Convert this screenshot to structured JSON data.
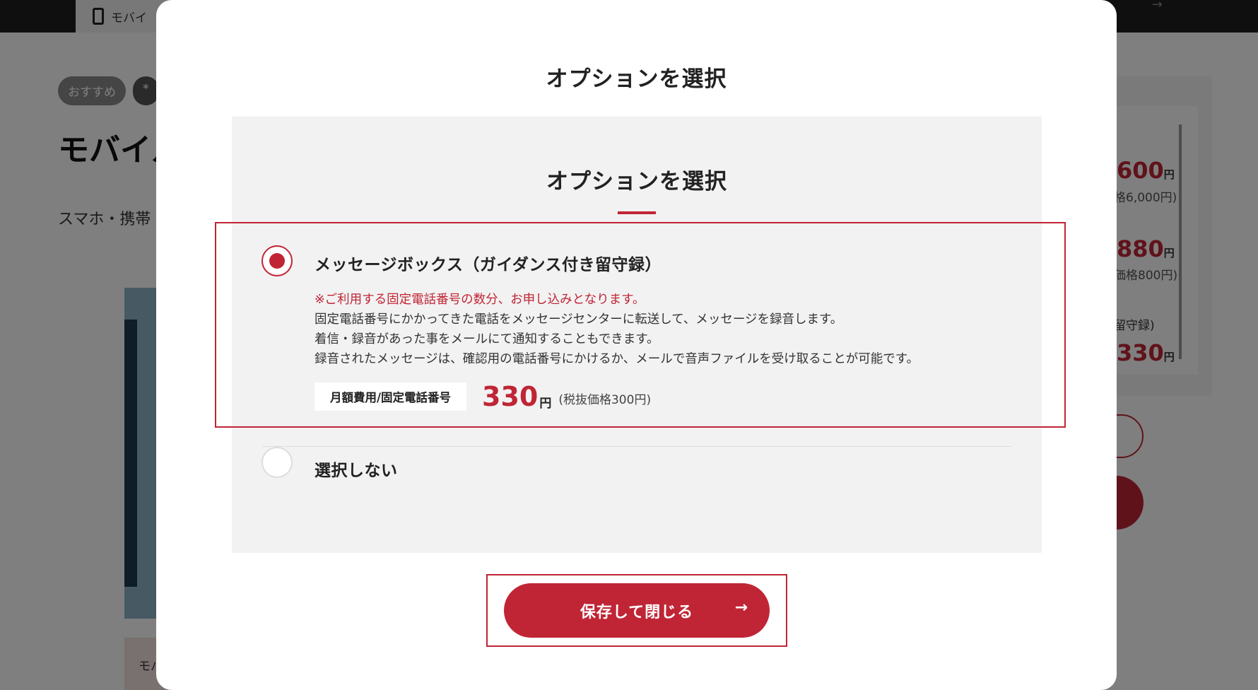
{
  "background": {
    "topbar_tab": "モバイ",
    "tags": [
      "おすすめ",
      "*"
    ],
    "title": "モバイル",
    "subtitle": "スマホ・携帯",
    "product_card": "モバ\n（",
    "side": {
      "prices": [
        {
          "value": "600",
          "unit": "円",
          "note": "格6,000円)"
        },
        {
          "value": "880",
          "unit": "円",
          "note": "価格800円)"
        },
        {
          "value": "330",
          "unit": "円"
        }
      ],
      "label": "留守録)"
    }
  },
  "modal": {
    "title": "オプションを選択",
    "options_title": "オプションを選択",
    "options": [
      {
        "label": "メッセージボックス（ガイダンス付き留守録）",
        "selected": true,
        "note": "※ご利用する固定電話番号の数分、お申し込みとなります。",
        "description": [
          "固定電話番号にかかってきた電話をメッセージセンターに転送して、メッセージを録音します。",
          "着信・録音があった事をメールにて通知することもできます。",
          "録音されたメッセージは、確認用の電話番号にかけるか、メールで音声ファイルを受け取ることが可能です。"
        ],
        "fee_label": "月額費用/固定電話番号",
        "price": "330",
        "price_unit": "円",
        "price_tax_note": "(税抜価格300円)"
      },
      {
        "label": "選択しない",
        "selected": false
      }
    ],
    "save_button": "保存して閉じる",
    "save_arrow": "→"
  },
  "colors": {
    "accent": "#c02535",
    "panel": "#f2f2f2",
    "overlay": "rgba(0,0,0,0.5)"
  }
}
